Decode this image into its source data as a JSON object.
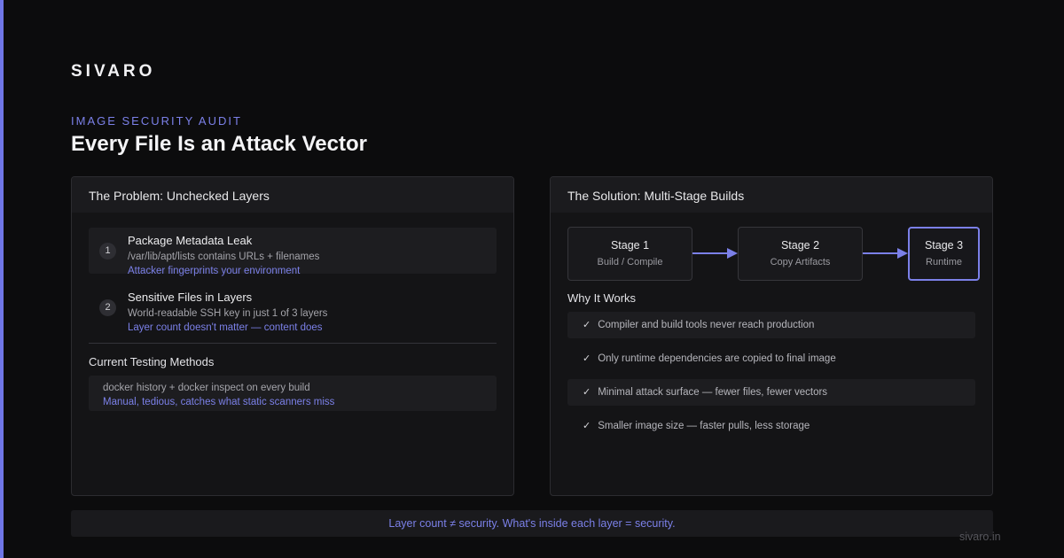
{
  "brand": "SIVARO",
  "eyebrow": "IMAGE SECURITY AUDIT",
  "title": "Every File Is an Attack Vector",
  "accent_color": "#6f76e6",
  "problem": {
    "heading": "The Problem: Unchecked Layers",
    "issues": [
      {
        "number": "1",
        "title": "Package Metadata Leak",
        "detail": "/var/lib/apt/lists contains URLs + filenames",
        "impact": "Attacker fingerprints your environment"
      },
      {
        "number": "2",
        "title": "Sensitive Files in Layers",
        "detail": "World-readable SSH key in just 1 of 3 layers",
        "impact": "Layer count doesn't matter — content does"
      }
    ],
    "methods_heading": "Current Testing Methods",
    "method": {
      "detail": "docker history + docker inspect on every build",
      "impact": "Manual, tedious, catches what static scanners miss"
    }
  },
  "solution": {
    "heading": "The Solution: Multi-Stage Builds",
    "stages": [
      {
        "name": "Stage 1",
        "desc": "Build / Compile"
      },
      {
        "name": "Stage 2",
        "desc": "Copy Artifacts"
      },
      {
        "name": "Stage 3",
        "desc": "Runtime"
      }
    ],
    "why_heading": "Why It Works",
    "check_icon": "✓",
    "reasons": [
      "Compiler and build tools never reach production",
      "Only runtime dependencies are copied to final image",
      "Minimal attack surface — fewer files, fewer vectors",
      "Smaller image size — faster pulls, less storage"
    ]
  },
  "footer_note": "Layer count ≠ security. What's inside each layer = security.",
  "site": "sivaro.in"
}
